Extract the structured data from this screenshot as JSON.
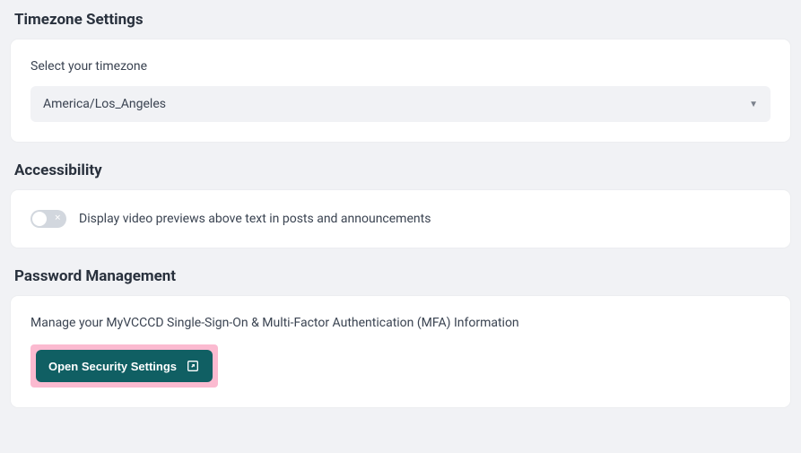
{
  "timezone": {
    "heading": "Timezone Settings",
    "field_label": "Select your timezone",
    "selected": "America/Los_Angeles"
  },
  "accessibility": {
    "heading": "Accessibility",
    "toggle_label": "Display video previews above text in posts and announcements",
    "toggle_on": false
  },
  "password": {
    "heading": "Password Management",
    "description": "Manage your MyVCCCD Single-Sign-On & Multi-Factor Authentication (MFA) Information",
    "button_label": "Open Security Settings"
  },
  "colors": {
    "page_bg": "#f1f2f5",
    "card_bg": "#ffffff",
    "text": "#29313d",
    "button_bg": "#105f63",
    "highlight": "#fbbad0"
  }
}
